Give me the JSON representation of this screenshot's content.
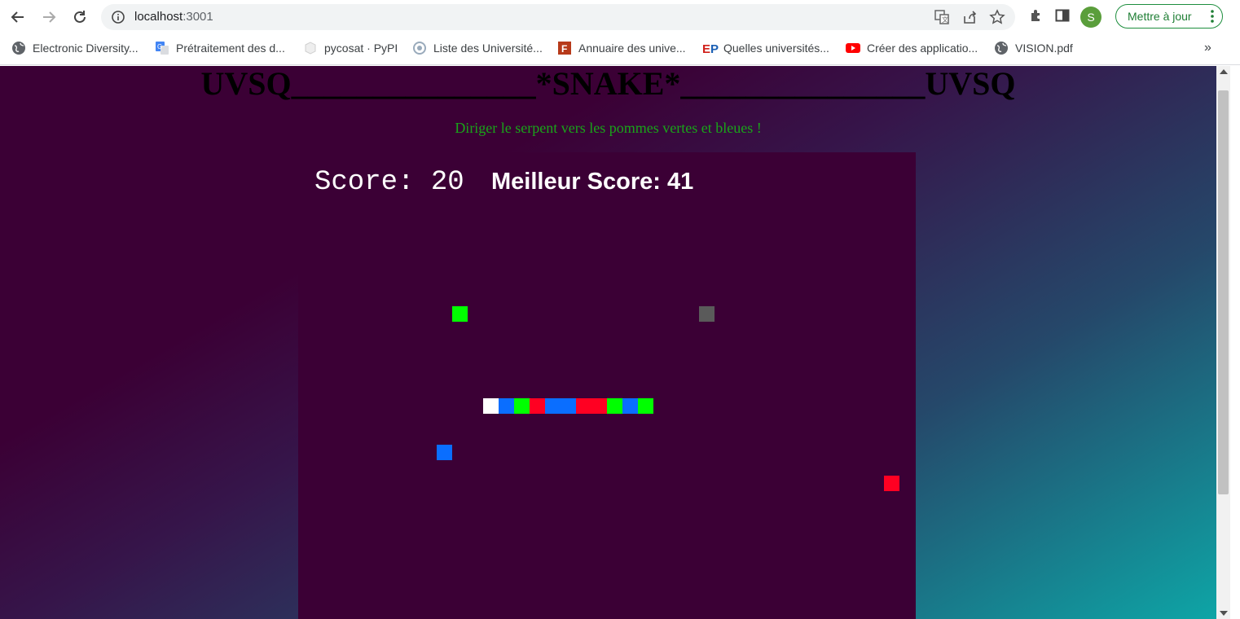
{
  "browser": {
    "url_host": "localhost",
    "url_port": ":3001",
    "update_label": "Mettre à jour",
    "profile_initial": "S"
  },
  "bookmarks": [
    {
      "label": "Electronic Diversity...",
      "icon": "globe-icon"
    },
    {
      "label": "Prétraitement des d...",
      "icon": "google-translate-icon"
    },
    {
      "label": "pycosat · PyPI",
      "icon": "pypi-icon"
    },
    {
      "label": "Liste des Université...",
      "icon": "site-icon"
    },
    {
      "label": "Annuaire des unive...",
      "icon": "site-icon"
    },
    {
      "label": "Quelles universités...",
      "icon": "ep-icon"
    },
    {
      "label": "Créer des applicatio...",
      "icon": "youtube-icon"
    },
    {
      "label": "VISION.pdf",
      "icon": "globe-icon"
    }
  ],
  "page": {
    "title": "UVSQ_______________*SNAKE*_______________UVSQ",
    "subtitle": "Diriger le serpent vers les pommes vertes et bleues !"
  },
  "game": {
    "score_label": "Score: 20",
    "best_label": "Meilleur Score: 41",
    "colors": {
      "green": "#00ff00",
      "blue": "#0a6eff",
      "red": "#ff0022",
      "white": "#ffffff",
      "gray": "#5a5a5a",
      "board": "#3b0035"
    }
  }
}
